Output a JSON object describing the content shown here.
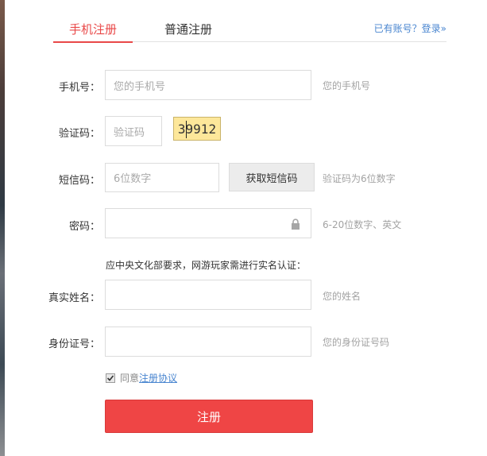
{
  "tabs": {
    "mobile": "手机注册",
    "normal": "普通注册",
    "login_link": "已有账号？登录»"
  },
  "form": {
    "phone": {
      "label": "手机号：",
      "placeholder": "您的手机号",
      "hint": "您的手机号"
    },
    "captcha": {
      "label": "验证码：",
      "placeholder": "验证码",
      "image_text": "39912"
    },
    "sms": {
      "label": "短信码：",
      "placeholder": "6位数字",
      "button": "获取短信码",
      "hint": "验证码为6位数字"
    },
    "password": {
      "label": "密码：",
      "hint": "6-20位数字、英文",
      "icon": "lock-icon"
    },
    "notice": "应中央文化部要求，网游玩家需进行实名认证：",
    "real_name": {
      "label": "真实姓名：",
      "hint": "您的姓名"
    },
    "id_number": {
      "label": "身份证号：",
      "hint": "您的身份证号码"
    },
    "agreement": {
      "prefix": "同意",
      "link": "注册协议",
      "checked": true
    },
    "submit": "注册"
  },
  "colors": {
    "accent": "#ef4545",
    "link": "#4a86d0",
    "captcha_bg": "#fde79a"
  }
}
